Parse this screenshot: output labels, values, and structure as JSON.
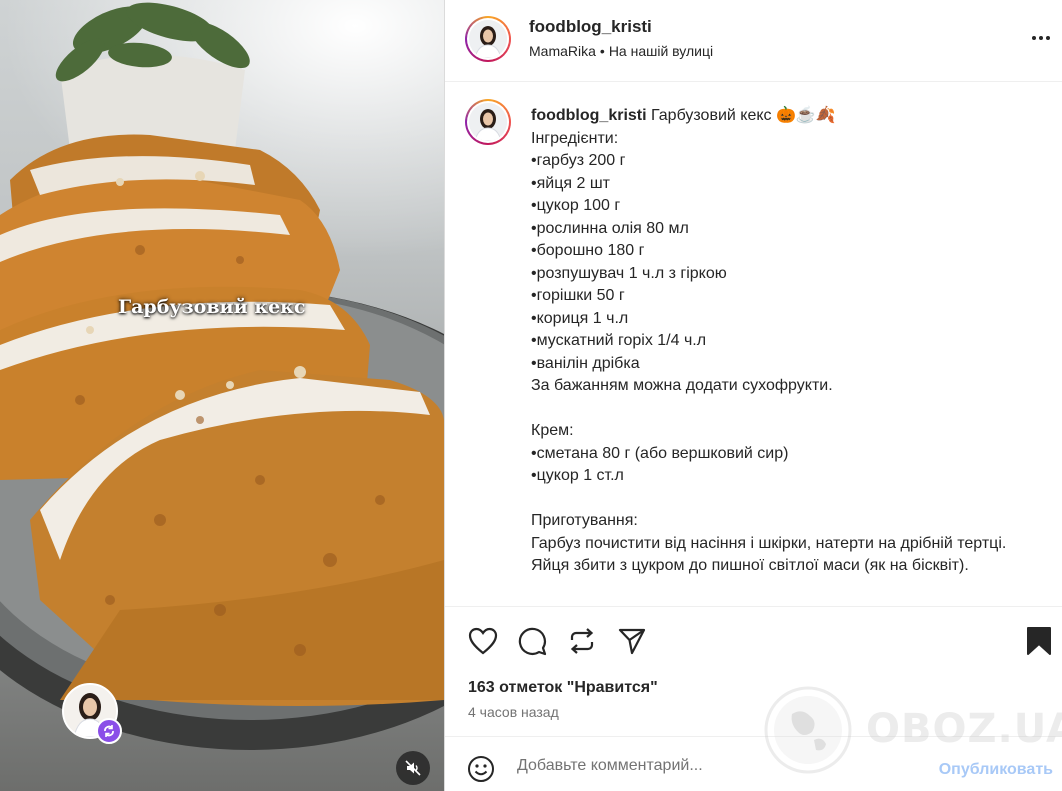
{
  "media": {
    "overlay_title": "Гарбузовий кекс"
  },
  "header": {
    "username": "foodblog_kristi",
    "audio": "MamaRika",
    "location": "На нашій вулиці",
    "more_icon": "more-horizontal-icon"
  },
  "caption": {
    "username": "foodblog_kristi",
    "title": "Гарбузовий кекс 🎃☕🍂",
    "lines": [
      "Інгредієнти:",
      "•гарбуз 200 г",
      "•яйця 2 шт",
      "•цукор 100 г",
      "•рослинна олія 80 мл",
      "•борошно 180 г",
      "•розпушувач 1 ч.л з гіркою",
      "•горішки 50 г",
      "•кориця 1 ч.л",
      "•мускатний горіх 1/4 ч.л",
      "•ванілін дрібка",
      "За бажанням можна додати сухофрукти.",
      "",
      "Крем:",
      "•сметана 80 г (або вершковий сир)",
      "•цукор 1 ст.л",
      "",
      "Приготування:",
      "Гарбуз почистити від насіння і шкірки, натерти на дрібній тертці.",
      "Яйця збити з цукром до пишної світлої маси (як на бісквіт)."
    ]
  },
  "actions": {
    "likes": "163 отметок \"Нравится\"",
    "time": "4 часов назад",
    "icons": [
      "heart-icon",
      "comment-icon",
      "repost-icon",
      "share-icon",
      "save-icon"
    ]
  },
  "comment": {
    "placeholder": "Добавьте комментарий...",
    "publish_label": "Опубликовать"
  },
  "watermark": {
    "text": "OBOZ.UA"
  },
  "colors": {
    "publish": "#a8c9f7",
    "remix_badge": "#8a4ee8",
    "avatar_ring": "#ef5350"
  }
}
